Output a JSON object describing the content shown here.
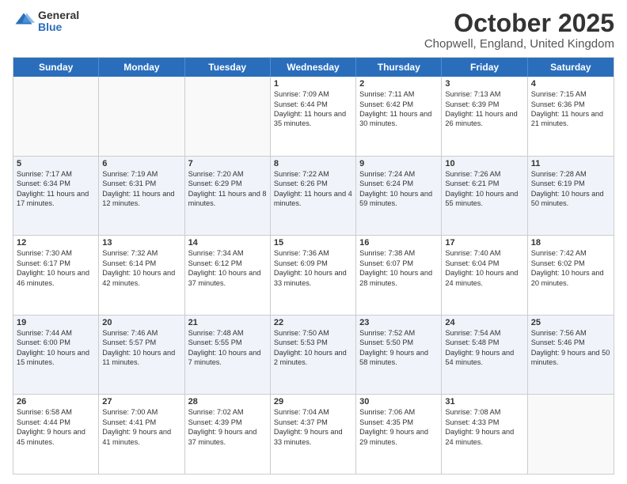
{
  "header": {
    "logo_general": "General",
    "logo_blue": "Blue",
    "title": "October 2025",
    "subtitle": "Chopwell, England, United Kingdom"
  },
  "days_of_week": [
    "Sunday",
    "Monday",
    "Tuesday",
    "Wednesday",
    "Thursday",
    "Friday",
    "Saturday"
  ],
  "weeks": [
    {
      "alt": false,
      "cells": [
        {
          "day": "",
          "sunrise": "",
          "sunset": "",
          "daylight": "",
          "empty": true
        },
        {
          "day": "",
          "sunrise": "",
          "sunset": "",
          "daylight": "",
          "empty": true
        },
        {
          "day": "",
          "sunrise": "",
          "sunset": "",
          "daylight": "",
          "empty": true
        },
        {
          "day": "1",
          "sunrise": "Sunrise: 7:09 AM",
          "sunset": "Sunset: 6:44 PM",
          "daylight": "Daylight: 11 hours and 35 minutes.",
          "empty": false
        },
        {
          "day": "2",
          "sunrise": "Sunrise: 7:11 AM",
          "sunset": "Sunset: 6:42 PM",
          "daylight": "Daylight: 11 hours and 30 minutes.",
          "empty": false
        },
        {
          "day": "3",
          "sunrise": "Sunrise: 7:13 AM",
          "sunset": "Sunset: 6:39 PM",
          "daylight": "Daylight: 11 hours and 26 minutes.",
          "empty": false
        },
        {
          "day": "4",
          "sunrise": "Sunrise: 7:15 AM",
          "sunset": "Sunset: 6:36 PM",
          "daylight": "Daylight: 11 hours and 21 minutes.",
          "empty": false
        }
      ]
    },
    {
      "alt": true,
      "cells": [
        {
          "day": "5",
          "sunrise": "Sunrise: 7:17 AM",
          "sunset": "Sunset: 6:34 PM",
          "daylight": "Daylight: 11 hours and 17 minutes.",
          "empty": false
        },
        {
          "day": "6",
          "sunrise": "Sunrise: 7:19 AM",
          "sunset": "Sunset: 6:31 PM",
          "daylight": "Daylight: 11 hours and 12 minutes.",
          "empty": false
        },
        {
          "day": "7",
          "sunrise": "Sunrise: 7:20 AM",
          "sunset": "Sunset: 6:29 PM",
          "daylight": "Daylight: 11 hours and 8 minutes.",
          "empty": false
        },
        {
          "day": "8",
          "sunrise": "Sunrise: 7:22 AM",
          "sunset": "Sunset: 6:26 PM",
          "daylight": "Daylight: 11 hours and 4 minutes.",
          "empty": false
        },
        {
          "day": "9",
          "sunrise": "Sunrise: 7:24 AM",
          "sunset": "Sunset: 6:24 PM",
          "daylight": "Daylight: 10 hours and 59 minutes.",
          "empty": false
        },
        {
          "day": "10",
          "sunrise": "Sunrise: 7:26 AM",
          "sunset": "Sunset: 6:21 PM",
          "daylight": "Daylight: 10 hours and 55 minutes.",
          "empty": false
        },
        {
          "day": "11",
          "sunrise": "Sunrise: 7:28 AM",
          "sunset": "Sunset: 6:19 PM",
          "daylight": "Daylight: 10 hours and 50 minutes.",
          "empty": false
        }
      ]
    },
    {
      "alt": false,
      "cells": [
        {
          "day": "12",
          "sunrise": "Sunrise: 7:30 AM",
          "sunset": "Sunset: 6:17 PM",
          "daylight": "Daylight: 10 hours and 46 minutes.",
          "empty": false
        },
        {
          "day": "13",
          "sunrise": "Sunrise: 7:32 AM",
          "sunset": "Sunset: 6:14 PM",
          "daylight": "Daylight: 10 hours and 42 minutes.",
          "empty": false
        },
        {
          "day": "14",
          "sunrise": "Sunrise: 7:34 AM",
          "sunset": "Sunset: 6:12 PM",
          "daylight": "Daylight: 10 hours and 37 minutes.",
          "empty": false
        },
        {
          "day": "15",
          "sunrise": "Sunrise: 7:36 AM",
          "sunset": "Sunset: 6:09 PM",
          "daylight": "Daylight: 10 hours and 33 minutes.",
          "empty": false
        },
        {
          "day": "16",
          "sunrise": "Sunrise: 7:38 AM",
          "sunset": "Sunset: 6:07 PM",
          "daylight": "Daylight: 10 hours and 28 minutes.",
          "empty": false
        },
        {
          "day": "17",
          "sunrise": "Sunrise: 7:40 AM",
          "sunset": "Sunset: 6:04 PM",
          "daylight": "Daylight: 10 hours and 24 minutes.",
          "empty": false
        },
        {
          "day": "18",
          "sunrise": "Sunrise: 7:42 AM",
          "sunset": "Sunset: 6:02 PM",
          "daylight": "Daylight: 10 hours and 20 minutes.",
          "empty": false
        }
      ]
    },
    {
      "alt": true,
      "cells": [
        {
          "day": "19",
          "sunrise": "Sunrise: 7:44 AM",
          "sunset": "Sunset: 6:00 PM",
          "daylight": "Daylight: 10 hours and 15 minutes.",
          "empty": false
        },
        {
          "day": "20",
          "sunrise": "Sunrise: 7:46 AM",
          "sunset": "Sunset: 5:57 PM",
          "daylight": "Daylight: 10 hours and 11 minutes.",
          "empty": false
        },
        {
          "day": "21",
          "sunrise": "Sunrise: 7:48 AM",
          "sunset": "Sunset: 5:55 PM",
          "daylight": "Daylight: 10 hours and 7 minutes.",
          "empty": false
        },
        {
          "day": "22",
          "sunrise": "Sunrise: 7:50 AM",
          "sunset": "Sunset: 5:53 PM",
          "daylight": "Daylight: 10 hours and 2 minutes.",
          "empty": false
        },
        {
          "day": "23",
          "sunrise": "Sunrise: 7:52 AM",
          "sunset": "Sunset: 5:50 PM",
          "daylight": "Daylight: 9 hours and 58 minutes.",
          "empty": false
        },
        {
          "day": "24",
          "sunrise": "Sunrise: 7:54 AM",
          "sunset": "Sunset: 5:48 PM",
          "daylight": "Daylight: 9 hours and 54 minutes.",
          "empty": false
        },
        {
          "day": "25",
          "sunrise": "Sunrise: 7:56 AM",
          "sunset": "Sunset: 5:46 PM",
          "daylight": "Daylight: 9 hours and 50 minutes.",
          "empty": false
        }
      ]
    },
    {
      "alt": false,
      "cells": [
        {
          "day": "26",
          "sunrise": "Sunrise: 6:58 AM",
          "sunset": "Sunset: 4:44 PM",
          "daylight": "Daylight: 9 hours and 45 minutes.",
          "empty": false
        },
        {
          "day": "27",
          "sunrise": "Sunrise: 7:00 AM",
          "sunset": "Sunset: 4:41 PM",
          "daylight": "Daylight: 9 hours and 41 minutes.",
          "empty": false
        },
        {
          "day": "28",
          "sunrise": "Sunrise: 7:02 AM",
          "sunset": "Sunset: 4:39 PM",
          "daylight": "Daylight: 9 hours and 37 minutes.",
          "empty": false
        },
        {
          "day": "29",
          "sunrise": "Sunrise: 7:04 AM",
          "sunset": "Sunset: 4:37 PM",
          "daylight": "Daylight: 9 hours and 33 minutes.",
          "empty": false
        },
        {
          "day": "30",
          "sunrise": "Sunrise: 7:06 AM",
          "sunset": "Sunset: 4:35 PM",
          "daylight": "Daylight: 9 hours and 29 minutes.",
          "empty": false
        },
        {
          "day": "31",
          "sunrise": "Sunrise: 7:08 AM",
          "sunset": "Sunset: 4:33 PM",
          "daylight": "Daylight: 9 hours and 24 minutes.",
          "empty": false
        },
        {
          "day": "",
          "sunrise": "",
          "sunset": "",
          "daylight": "",
          "empty": true
        }
      ]
    }
  ]
}
